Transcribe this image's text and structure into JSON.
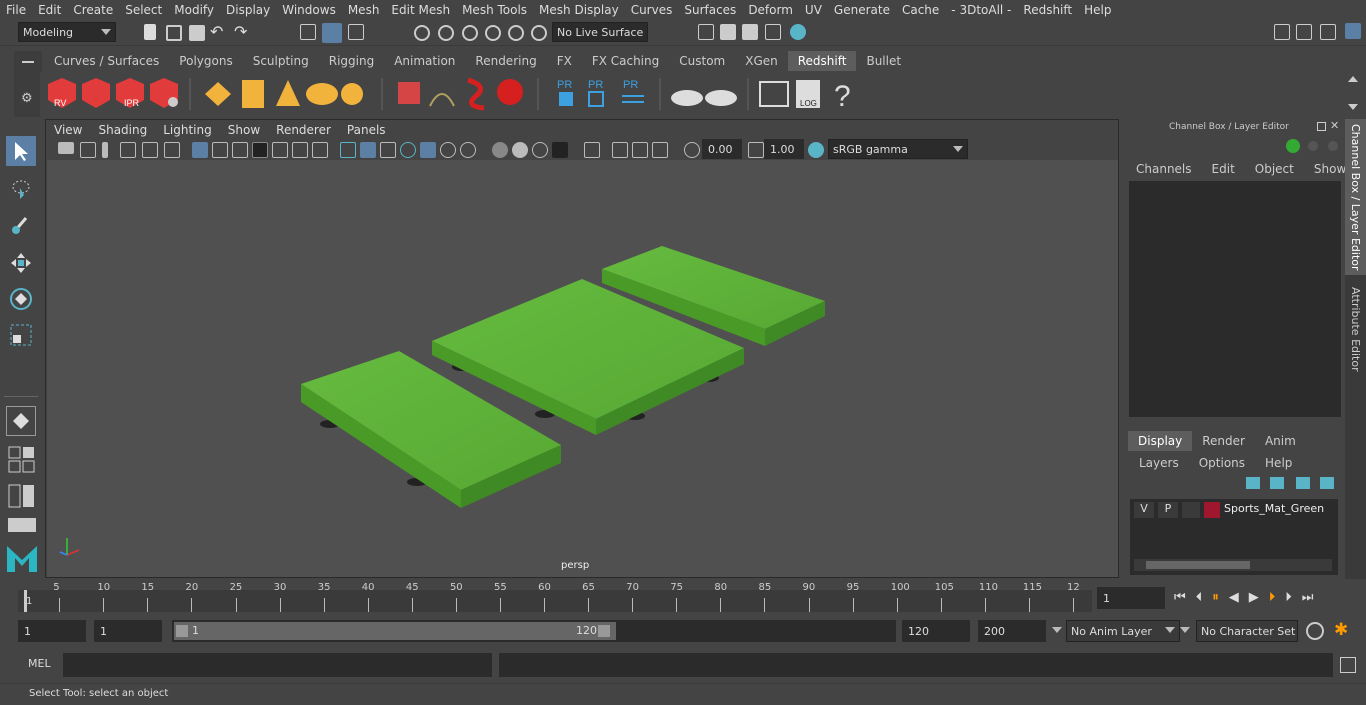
{
  "menu": [
    "File",
    "Edit",
    "Create",
    "Select",
    "Modify",
    "Display",
    "Windows",
    "Mesh",
    "Edit Mesh",
    "Mesh Tools",
    "Mesh Display",
    "Curves",
    "Surfaces",
    "Deform",
    "UV",
    "Generate",
    "Cache",
    "- 3DtoAll -",
    "Redshift",
    "Help"
  ],
  "status": {
    "mode": "Modeling",
    "live_surface": "No Live Surface"
  },
  "shelf_tabs": [
    "Curves / Surfaces",
    "Polygons",
    "Sculpting",
    "Rigging",
    "Animation",
    "Rendering",
    "FX",
    "FX Caching",
    "Custom",
    "XGen",
    "Redshift",
    "Bullet"
  ],
  "shelf_active": "Redshift",
  "shelf_labels": {
    "rv": "RV",
    "ipr": "IPR",
    "pr1": "PR",
    "pr2": "PR",
    "pr3": "PR",
    "log": "LOG",
    "help": "?"
  },
  "viewport": {
    "menu": [
      "View",
      "Shading",
      "Lighting",
      "Show",
      "Renderer",
      "Panels"
    ],
    "exposure": "0.00",
    "gamma": "1.00",
    "color_space": "sRGB gamma",
    "camera": "persp"
  },
  "right_panel": {
    "title": "Channel Box / Layer Editor",
    "menu": [
      "Channels",
      "Edit",
      "Object",
      "Show"
    ],
    "layer_tabs": [
      "Display",
      "Render",
      "Anim"
    ],
    "layer_active": "Display",
    "layer_menu": [
      "Layers",
      "Options",
      "Help"
    ],
    "layer": {
      "v": "V",
      "p": "P",
      "name": "Sports_Mat_Green",
      "color": "#a0162e"
    }
  },
  "side_tabs": [
    "Channel Box / Layer Editor",
    "Attribute Editor"
  ],
  "timeline": {
    "ticks": [
      "5",
      "10",
      "15",
      "20",
      "25",
      "30",
      "35",
      "40",
      "45",
      "50",
      "55",
      "60",
      "65",
      "70",
      "75",
      "80",
      "85",
      "90",
      "95",
      "100",
      "105",
      "110",
      "115",
      "12"
    ],
    "start_mark": "1",
    "current_frame": "1"
  },
  "range": {
    "start": "1",
    "playback_start": "1",
    "slider_start": "1",
    "slider_end": "120",
    "playback_end": "120",
    "end": "200",
    "anim_layer": "No Anim Layer",
    "char_set": "No Character Set"
  },
  "mel": {
    "label": "MEL"
  },
  "help_line": "Select Tool: select an object",
  "colors": {
    "mat": "#5fb33a",
    "mat_dark": "#3f8a24",
    "accent": "#5d5d5d"
  }
}
